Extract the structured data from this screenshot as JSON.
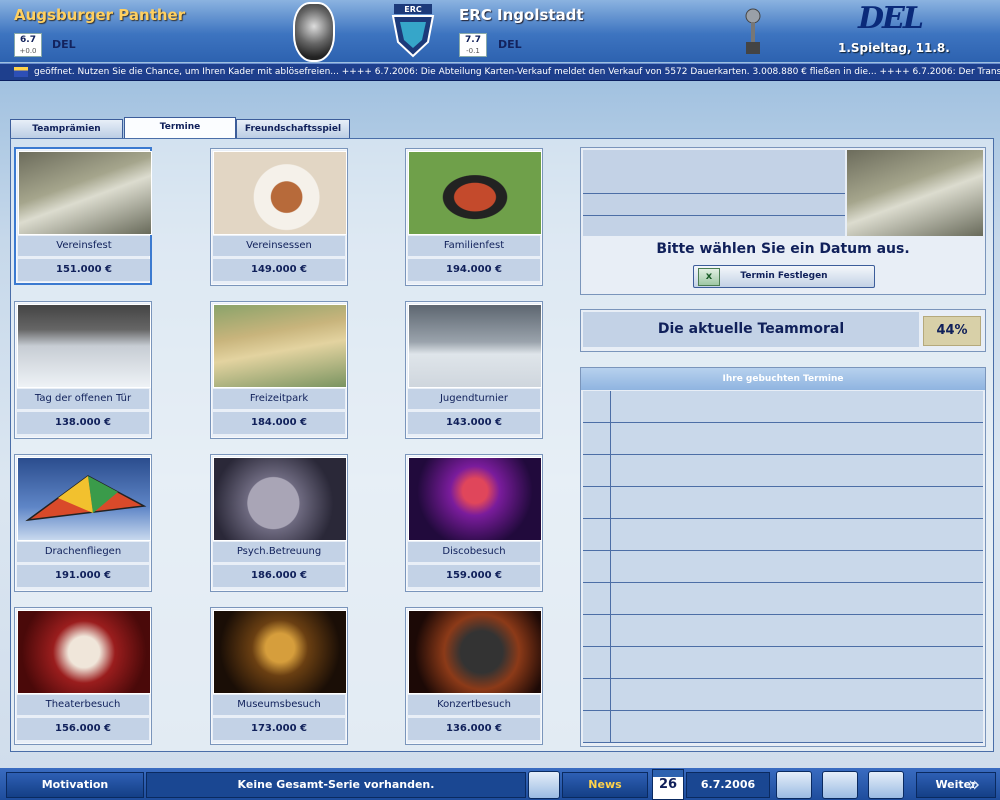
{
  "header": {
    "home_team": "Augsburger Panther",
    "home_rating": "6.7",
    "home_rating_delta": "+0.0",
    "home_league": "DEL",
    "away_team": "ERC Ingolstadt",
    "away_rating": "7.7",
    "away_rating_delta": "-0.1",
    "away_league": "DEL",
    "league_logo_text": "DEL",
    "matchday": "1.Spieltag, 11.8."
  },
  "ticker": {
    "text": "geöffnet. Nutzen Sie die Chance, um Ihren Kader mit ablösefreien...    ++++  6.7.2006: Die Abteilung Karten-Verkauf meldet den Verkauf von 5572 Dauerkarten. 3.008.880 € fließen in die...    ++++  6.7.2006: Der Transfermarkt ist ab sofort geöffn"
  },
  "tabs": [
    {
      "label": "Teamprämien"
    },
    {
      "label": "Termine"
    },
    {
      "label": "Freundschaftsspiel"
    }
  ],
  "events": [
    {
      "label": "Vereinsfest",
      "price": "151.000 €",
      "icon": "champagne-image"
    },
    {
      "label": "Vereinsessen",
      "price": "149.000 €",
      "icon": "dinner-image"
    },
    {
      "label": "Familienfest",
      "price": "194.000 €",
      "icon": "barbecue-image"
    },
    {
      "label": "Tag der offenen Tür",
      "price": "138.000 €",
      "icon": "ice-rink-image"
    },
    {
      "label": "Freizeitpark",
      "price": "184.000 €",
      "icon": "roller-coaster-image"
    },
    {
      "label": "Jugendturnier",
      "price": "143.000 €",
      "icon": "hockey-player-image"
    },
    {
      "label": "Drachenfliegen",
      "price": "191.000 €",
      "icon": "hang-glider-image"
    },
    {
      "label": "Psych.Betreuung",
      "price": "186.000 €",
      "icon": "brain-image"
    },
    {
      "label": "Discobesuch",
      "price": "159.000 €",
      "icon": "disco-image"
    },
    {
      "label": "Theaterbesuch",
      "price": "156.000 €",
      "icon": "theatre-masks-image"
    },
    {
      "label": "Museumsbesuch",
      "price": "173.000 €",
      "icon": "museum-mask-image"
    },
    {
      "label": "Konzertbesuch",
      "price": "136.000 €",
      "icon": "grand-piano-image"
    }
  ],
  "info": {
    "prompt": "Bitte wählen Sie ein Datum aus.",
    "button_label": "Termin Festlegen"
  },
  "moral": {
    "label": "Die aktuelle Teammoral",
    "value": "44%"
  },
  "booked": {
    "title": "Ihre gebuchten Termine"
  },
  "bottom": {
    "motivation": "Motivation",
    "series": "Keine Gesamt-Serie vorhanden.",
    "news": "News",
    "calendar_day": "26",
    "date": "6.7.2006",
    "next": "Weiter"
  },
  "colors": {
    "accent": "#2d62b0",
    "home_team": "#ffd060",
    "moral_badge": "#d8d0a8"
  }
}
